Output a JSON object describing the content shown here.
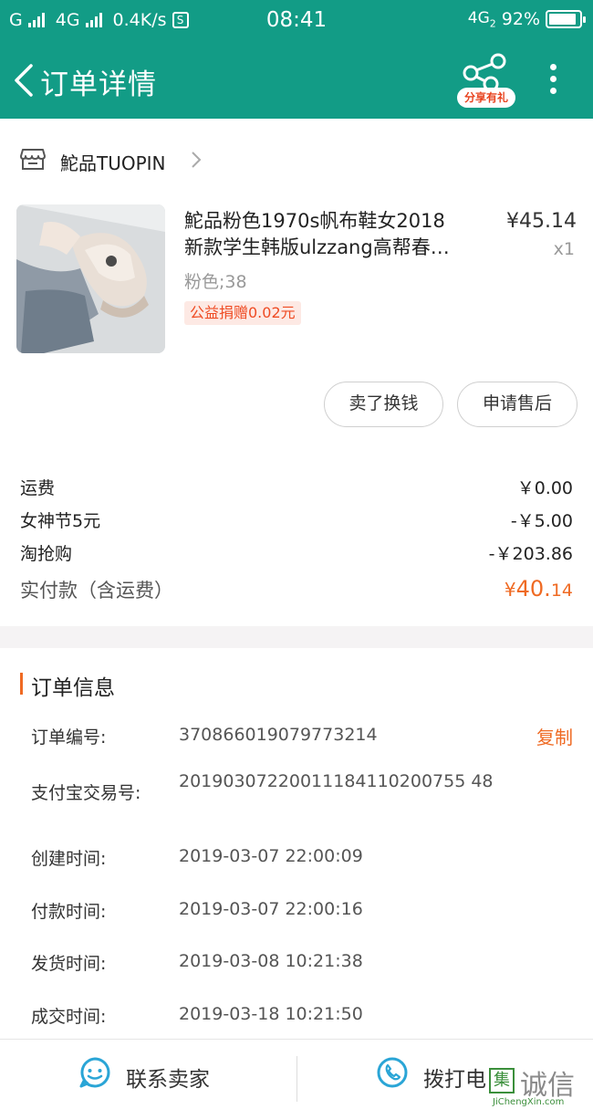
{
  "status_bar": {
    "carrier1": "G",
    "carrier2": "4G",
    "speed": "0.4K/s",
    "s_icon": "S",
    "time": "08:41",
    "network": "4G",
    "network_sub": "2",
    "battery": "92%",
    "battery_level": 0.92
  },
  "nav": {
    "title": "订单详情",
    "share_badge": "分享有礼",
    "icons": {
      "back": "back-arrow-icon",
      "share": "share-icon",
      "more": "more-vertical-icon"
    }
  },
  "shop": {
    "name": "鮀品TUOPIN"
  },
  "product": {
    "title_line1": "鮀品粉色1970s帆布鞋女2018",
    "title_line2": "新款学生韩版ulzzang高帮春…",
    "price": "¥45.14",
    "qty": "x1",
    "spec": "粉色;38",
    "charity": "公益捐赠0.02元"
  },
  "actions": {
    "sell": "卖了换钱",
    "after_sale": "申请售后"
  },
  "fees": {
    "shipping_label": "运费",
    "shipping_value": "￥0.00",
    "discount1_label": "女神节5元",
    "discount1_value": "-￥5.00",
    "discount2_label": "淘抢购",
    "discount2_value": "-￥203.86",
    "total_label": "实付款（含运费）",
    "total_currency": "¥",
    "total_int": "40.",
    "total_dec": "14"
  },
  "order_info": {
    "heading": "订单信息",
    "order_no_label": "订单编号:",
    "order_no": "370866019079773214",
    "copy": "复制",
    "alipay_label": "支付宝交易号:",
    "alipay_no": "20190307220011184110200755 48",
    "created_label": "创建时间:",
    "created": "2019-03-07 22:00:09",
    "paid_label": "付款时间:",
    "paid": "2019-03-07 22:00:16",
    "shipped_label": "发货时间:",
    "shipped": "2019-03-08 10:21:38",
    "done_label": "成交时间:",
    "done": "2019-03-18 10:21:50"
  },
  "bottom": {
    "contact": "联系卖家",
    "call": "拨打电",
    "watermark": "诚信",
    "watermark_badge": "集",
    "watermark_url": "JiChengXin.com"
  },
  "colors": {
    "primary": "#129c86",
    "accent": "#ef6a23",
    "link_blue": "#2aa5d6"
  }
}
